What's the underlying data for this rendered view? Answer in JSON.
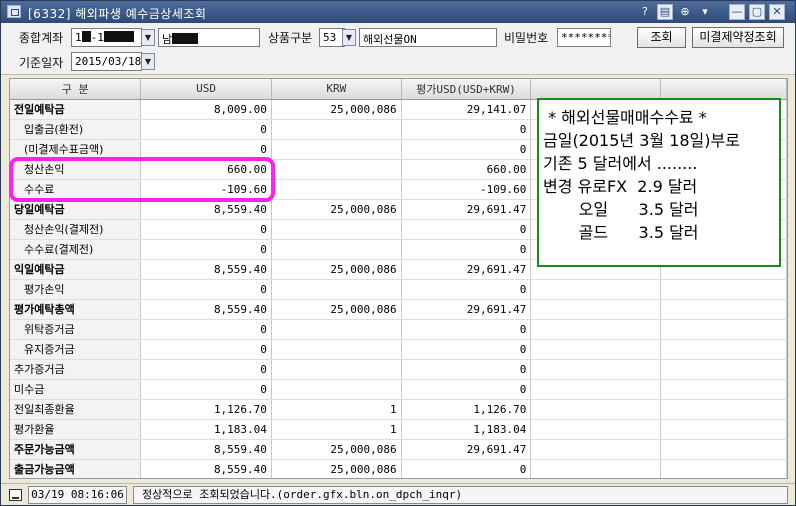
{
  "window": {
    "title": "[6332] 해외파생 예수금상세조회",
    "controls": [
      "?",
      "▤",
      "⊕",
      "▾",
      "—",
      "▢",
      "✕"
    ]
  },
  "form": {
    "account_label": "종합계좌",
    "account_prefix": "1",
    "account_middle": "-1",
    "account_owner": "남",
    "product_label": "상품구분",
    "product_code": "53",
    "product_name": "해외선물ON",
    "password_label": "비밀번호",
    "password_value": "********",
    "date_label": "기준일자",
    "date_value": "2015/03/18",
    "query_button": "조회",
    "unsettled_button": "미결제약정조회"
  },
  "table": {
    "headers": [
      "구 분",
      "USD",
      "KRW",
      "평가USD(USD+KRW)",
      "",
      ""
    ],
    "rows": [
      {
        "name": "전일예탁금",
        "usd": "8,009.00",
        "krw": "25,000,086",
        "eval": "29,141.07",
        "style": "bold"
      },
      {
        "name": "입출금(환전)",
        "usd": "0",
        "krw": "",
        "eval": "0",
        "style": "indent"
      },
      {
        "name": "(미결제수표금액)",
        "usd": "0",
        "krw": "",
        "eval": "0",
        "style": "indent"
      },
      {
        "name": "청산손익",
        "usd": "660.00",
        "krw": "",
        "eval": "660.00",
        "style": "indent"
      },
      {
        "name": "수수료",
        "usd": "-109.60",
        "krw": "",
        "eval": "-109.60",
        "style": "indent"
      },
      {
        "name": "당일예탁금",
        "usd": "8,559.40",
        "krw": "25,000,086",
        "eval": "29,691.47",
        "style": "bold"
      },
      {
        "name": "청산손익(결제전)",
        "usd": "0",
        "krw": "",
        "eval": "0",
        "style": "indent"
      },
      {
        "name": "수수료(결제전)",
        "usd": "0",
        "krw": "",
        "eval": "0",
        "style": "indent"
      },
      {
        "name": "익일예탁금",
        "usd": "8,559.40",
        "krw": "25,000,086",
        "eval": "29,691.47",
        "style": "bold"
      },
      {
        "name": "평가손익",
        "usd": "0",
        "krw": "",
        "eval": "0",
        "style": "indent"
      },
      {
        "name": "평가예탁총액",
        "usd": "8,559.40",
        "krw": "25,000,086",
        "eval": "29,691.47",
        "style": "bold"
      },
      {
        "name": "위탁증거금",
        "usd": "0",
        "krw": "",
        "eval": "0",
        "style": "indent"
      },
      {
        "name": "유지증거금",
        "usd": "0",
        "krw": "",
        "eval": "0",
        "style": "indent"
      },
      {
        "name": "추가증거금",
        "usd": "0",
        "krw": "",
        "eval": "0",
        "style": "plain"
      },
      {
        "name": "미수금",
        "usd": "0",
        "krw": "",
        "eval": "0",
        "style": "plain"
      },
      {
        "name": "전일최종환율",
        "usd": "1,126.70",
        "krw": "1",
        "eval": "1,126.70",
        "style": "plain"
      },
      {
        "name": "평가환율",
        "usd": "1,183.04",
        "krw": "1",
        "eval": "1,183.04",
        "style": "plain"
      },
      {
        "name": "주문가능금액",
        "usd": "8,559.40",
        "krw": "25,000,086",
        "eval": "29,691.47",
        "style": "bold"
      },
      {
        "name": "출금가능금액",
        "usd": "8,559.40",
        "krw": "25,000,086",
        "eval": "0",
        "style": "bold"
      }
    ]
  },
  "notice": {
    "lines": [
      " * 해외선물매매수수료 *",
      "금일(2015년 3월 18일)부로",
      "기존 5 달러에서 ........",
      "변경 유로FX  2.9 달러",
      "       오일      3.5 달러",
      "       골드      3.5 달러"
    ],
    "border_color": "#1a8a1a"
  },
  "highlight": {
    "color": "#ff22ee"
  },
  "status": {
    "time": "03/19 08:16:06",
    "message": "정상적으로 조회되었습니다.(order.gfx.bln.on_dpch_inqr)"
  }
}
